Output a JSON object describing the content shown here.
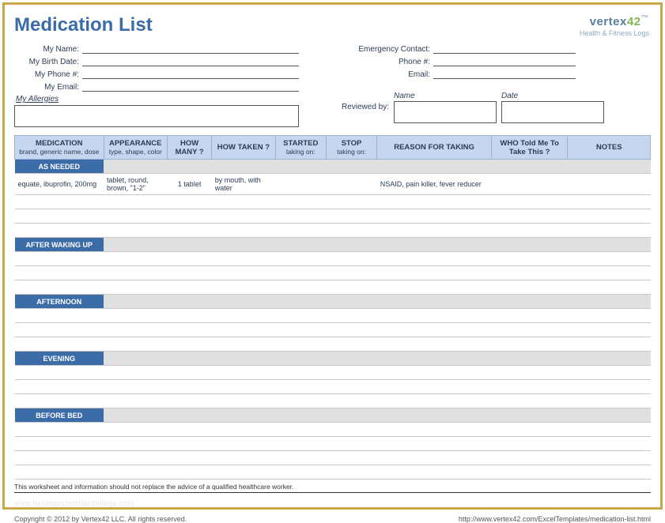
{
  "title": "Medication List",
  "logo": {
    "brand": "vertex",
    "brandNum": "42",
    "tm": "™",
    "tagline": "Health & Fitness Logs"
  },
  "personal": {
    "name_label": "My Name:",
    "birth_label": "My Birth Date:",
    "phone_label": "My Phone #:",
    "email_label": "My Email:"
  },
  "emergency": {
    "contact_label": "Emergency Contact:",
    "phone_label": "Phone #:",
    "email_label": "Email:"
  },
  "allergies_label": "My Allergies",
  "reviewed_label": "Reviewed by:",
  "name_head": "Name",
  "date_head": "Date",
  "columns": {
    "medication": {
      "main": "MEDICATION",
      "sub": "brand, generic name, dose"
    },
    "appearance": {
      "main": "APPEARANCE",
      "sub": "type, shape, color"
    },
    "howmany": {
      "main": "HOW MANY ?",
      "sub": ""
    },
    "howtaken": {
      "main": "HOW TAKEN ?",
      "sub": ""
    },
    "started": {
      "main": "STARTED",
      "sub": "taking on:"
    },
    "stop": {
      "main": "STOP",
      "sub": "taking on:"
    },
    "reason": {
      "main": "REASON FOR TAKING",
      "sub": ""
    },
    "who": {
      "main": "WHO Told Me To Take This ?",
      "sub": ""
    },
    "notes": {
      "main": "NOTES",
      "sub": ""
    }
  },
  "sections": {
    "asneeded": "AS NEEDED",
    "afterwaking": "AFTER WAKING UP",
    "afternoon": "AFTERNOON",
    "evening": "EVENING",
    "beforebed": "BEFORE BED"
  },
  "sample_row": {
    "medication": "equate, ibuprofin, 200mg",
    "appearance": "tablet, round, brown, \"1-2\"",
    "howmany": "1 tablet",
    "howtaken": "by mouth, with water",
    "started": "",
    "stop": "",
    "reason": "NSAID, pain killer, fever reducer",
    "who": "",
    "notes": ""
  },
  "disclaimer": "This worksheet and information should not replace the advice of a qualified healthcare worker.",
  "watermark": "www.heritagechristiancollege.com",
  "copyright": "Copyright © 2012 by Vertex42 LLC. All rights reserved.",
  "url": "http://www.vertex42.com/ExcelTemplates/medication-list.html"
}
